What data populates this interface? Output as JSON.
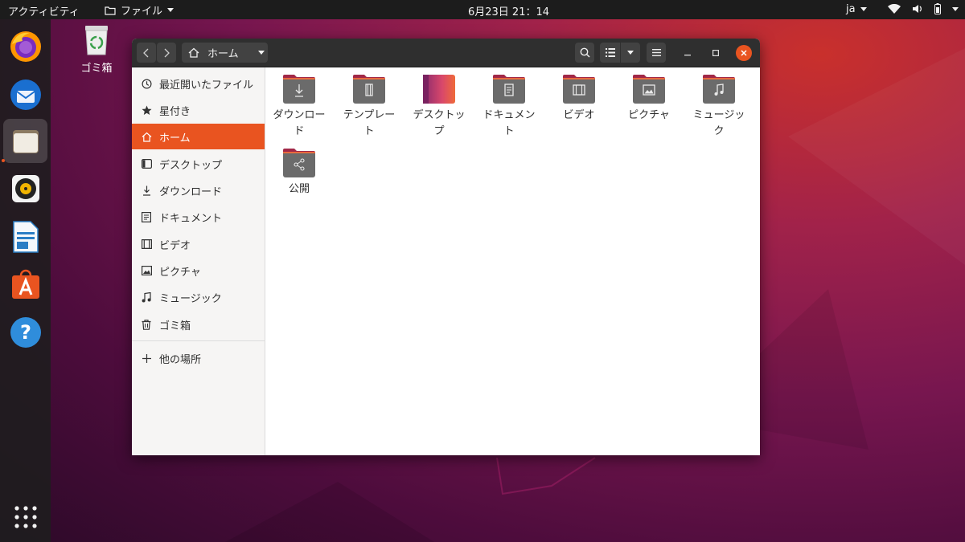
{
  "topbar": {
    "activities": "アクティビティ",
    "app_menu": "ファイル",
    "clock": "6月23日  21：14",
    "lang": "ja"
  },
  "dock": {
    "items": [
      "firefox",
      "thunderbird",
      "files",
      "rhythmbox",
      "libreoffice-writer",
      "software",
      "help",
      "show-applications"
    ]
  },
  "desktop": {
    "trash_label": "ゴミ箱"
  },
  "window": {
    "path": "ホーム",
    "sidebar": [
      {
        "label": "最近開いたファイル",
        "icon": "clock-icon"
      },
      {
        "label": "星付き",
        "icon": "star-icon"
      },
      {
        "label": "ホーム",
        "icon": "home-icon",
        "active": true
      },
      {
        "label": "デスクトップ",
        "icon": "desktop-icon"
      },
      {
        "label": "ダウンロード",
        "icon": "download-icon"
      },
      {
        "label": "ドキュメント",
        "icon": "document-icon"
      },
      {
        "label": "ビデオ",
        "icon": "video-icon"
      },
      {
        "label": "ピクチャ",
        "icon": "picture-icon"
      },
      {
        "label": "ミュージック",
        "icon": "music-icon"
      },
      {
        "label": "ゴミ箱",
        "icon": "trash-icon"
      }
    ],
    "other_locations": "他の場所",
    "files": [
      {
        "line1": "ダウンロー",
        "line2": "ド"
      },
      {
        "line1": "テンプレー",
        "line2": "ト"
      },
      {
        "line1": "デスクトッ",
        "line2": "プ"
      },
      {
        "line1": "ドキュメン",
        "line2": "ト"
      },
      {
        "line1": "ビデオ",
        "line2": ""
      },
      {
        "line1": "ピクチャ",
        "line2": ""
      },
      {
        "line1": "ミュージッ",
        "line2": "ク"
      },
      {
        "line1": "公開",
        "line2": ""
      }
    ]
  },
  "colors": {
    "accent": "#e95420",
    "folder_tab": "#a12848",
    "folder_body": "#6b6b6b"
  }
}
